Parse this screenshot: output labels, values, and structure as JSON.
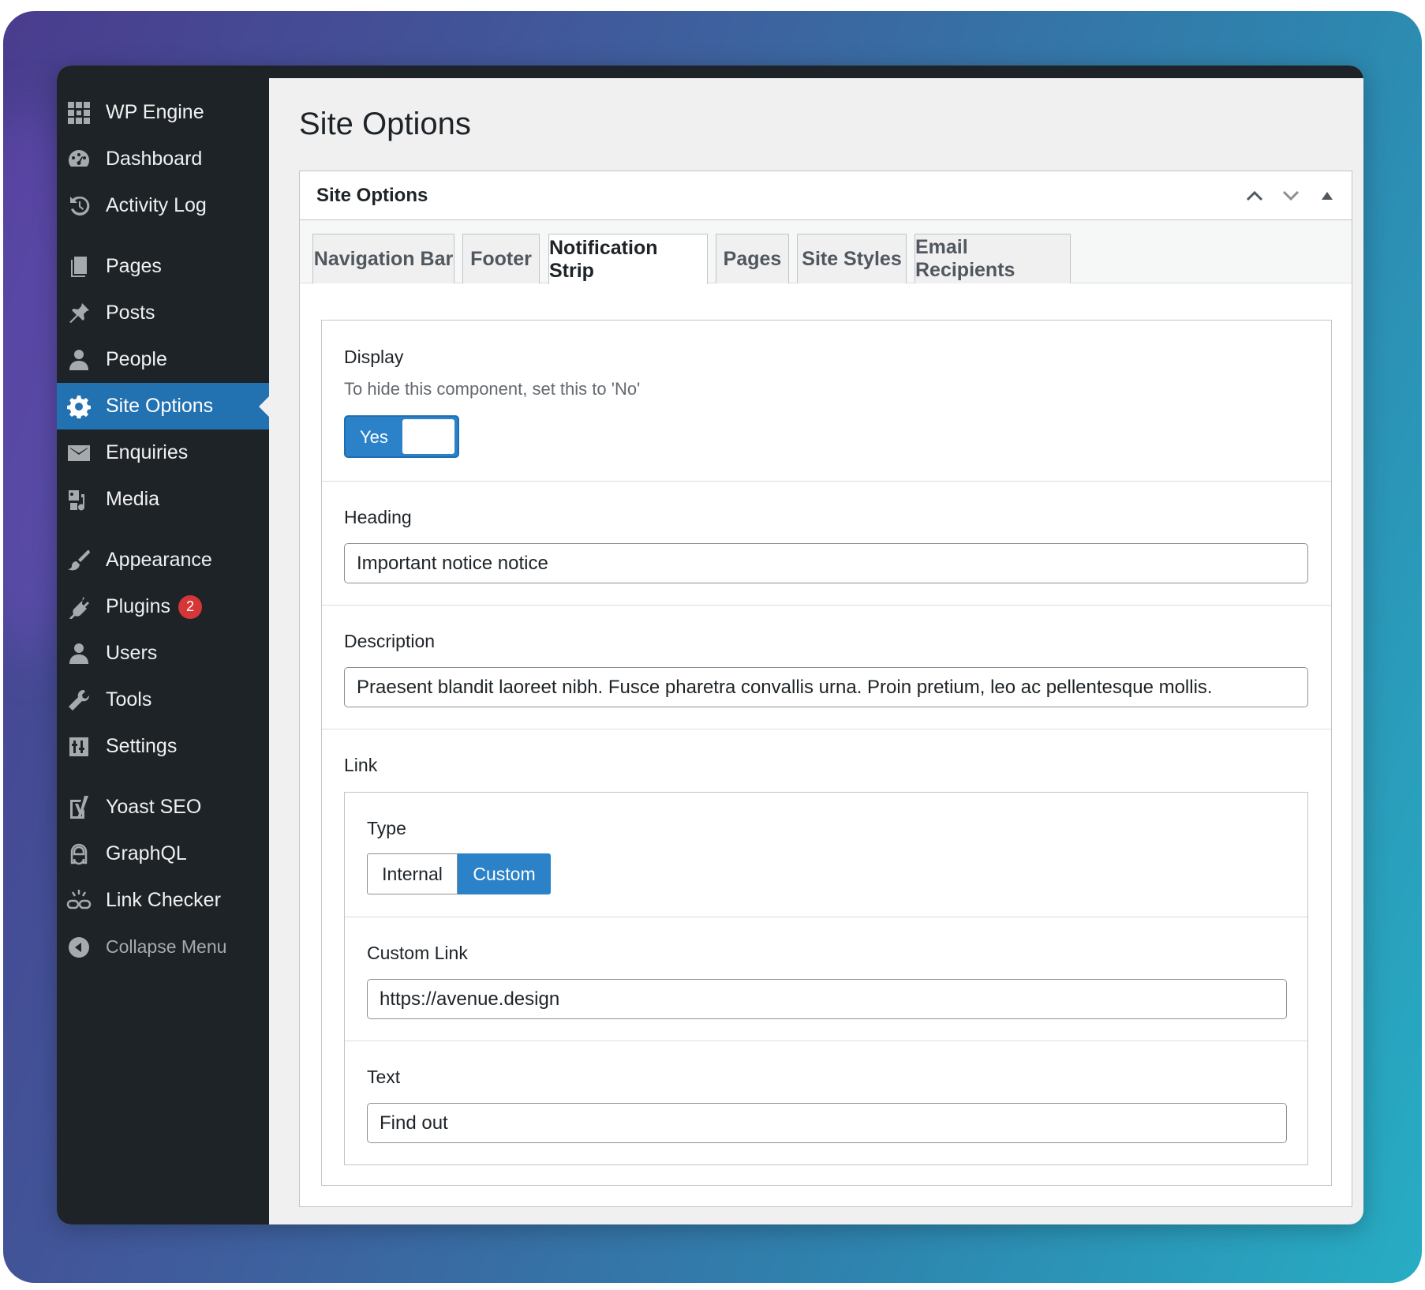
{
  "sidebar": {
    "items": [
      {
        "label": "WP Engine",
        "icon": "wp-engine-icon"
      },
      {
        "label": "Dashboard",
        "icon": "dashboard-icon"
      },
      {
        "label": "Activity Log",
        "icon": "history-icon"
      },
      {
        "label": "Pages",
        "icon": "pages-icon"
      },
      {
        "label": "Posts",
        "icon": "pin-icon"
      },
      {
        "label": "People",
        "icon": "person-icon"
      },
      {
        "label": "Site Options",
        "icon": "gear-icon"
      },
      {
        "label": "Enquiries",
        "icon": "envelope-icon"
      },
      {
        "label": "Media",
        "icon": "media-icon"
      },
      {
        "label": "Appearance",
        "icon": "brush-icon"
      },
      {
        "label": "Plugins",
        "icon": "plugin-icon",
        "badge": "2"
      },
      {
        "label": "Users",
        "icon": "user-icon"
      },
      {
        "label": "Tools",
        "icon": "wrench-icon"
      },
      {
        "label": "Settings",
        "icon": "settings-icon"
      },
      {
        "label": "Yoast SEO",
        "icon": "yoast-icon"
      },
      {
        "label": "GraphQL",
        "icon": "graphql-icon"
      },
      {
        "label": "Link Checker",
        "icon": "link-checker-icon"
      },
      {
        "label": "Collapse Menu",
        "icon": "collapse-icon"
      }
    ],
    "active": "Site Options"
  },
  "page": {
    "title": "Site Options"
  },
  "postbox": {
    "title": "Site Options",
    "tabs": [
      {
        "label": "Navigation Bar"
      },
      {
        "label": "Footer"
      },
      {
        "label": "Notification Strip",
        "active": true
      },
      {
        "label": "Pages"
      },
      {
        "label": "Site Styles"
      },
      {
        "label": "Email Recipients"
      }
    ]
  },
  "fields": {
    "display": {
      "label": "Display",
      "instructions": "To hide this component, set this to 'No'",
      "toggle_label": "Yes",
      "value": true
    },
    "heading": {
      "label": "Heading",
      "value": "Important notice notice"
    },
    "description": {
      "label": "Description",
      "value": "Praesent blandit laoreet nibh. Fusce pharetra convallis urna. Proin pretium, leo ac pellentesque mollis."
    },
    "link": {
      "label": "Link",
      "type": {
        "label": "Type",
        "options": [
          "Internal",
          "Custom"
        ],
        "selected": "Custom"
      },
      "custom_link": {
        "label": "Custom Link",
        "value": "https://avenue.design"
      },
      "text": {
        "label": "Text",
        "value": "Find out"
      }
    }
  },
  "colors": {
    "sidebar_bg": "#1d2327",
    "accent": "#2271b1",
    "toggle_on": "#2b82c9",
    "badge": "#d63638"
  }
}
